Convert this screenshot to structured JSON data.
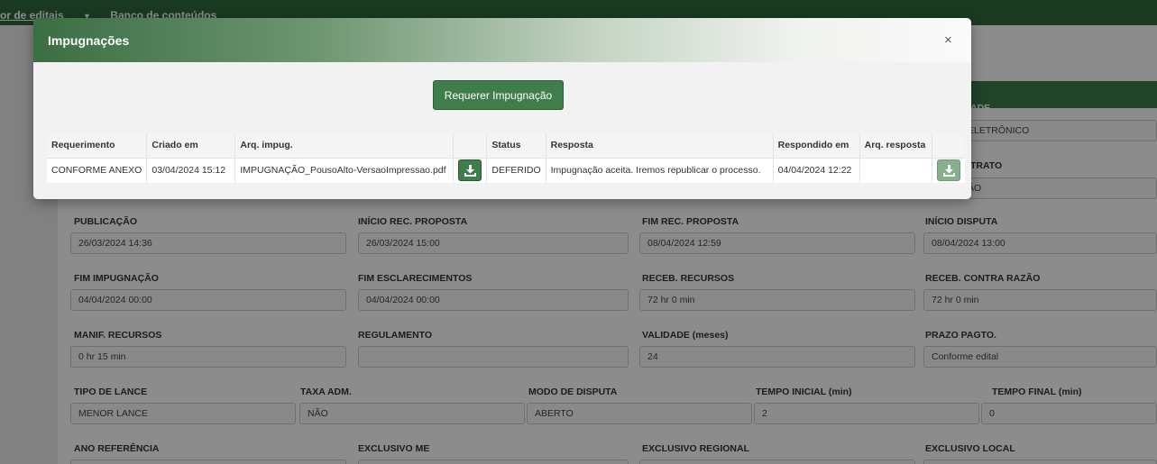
{
  "topbar": {
    "menu_left": "or de editais",
    "menu_dropdown_icon": "▼",
    "menu_right": "Banco de conteúdos"
  },
  "background_form": {
    "partial": {
      "label1": "ADE",
      "value1": "ELETRÔNICO",
      "label2": "TRATO",
      "value2": "ÃO"
    },
    "rows": [
      [
        {
          "label": "PUBLICAÇÃO",
          "value": "26/03/2024 14:36"
        },
        {
          "label": "INÍCIO REC. PROPOSTA",
          "value": "26/03/2024 15:00"
        },
        {
          "label": "FIM REC. PROPOSTA",
          "value": "08/04/2024 12:59"
        },
        {
          "label": "INÍCIO DISPUTA",
          "value": "08/04/2024 13:00"
        }
      ],
      [
        {
          "label": "FIM IMPUGNAÇÃO",
          "value": "04/04/2024 00:00"
        },
        {
          "label": "FIM ESCLARECIMENTOS",
          "value": "04/04/2024 00:00"
        },
        {
          "label": "RECEB. RECURSOS",
          "value": "72 hr 0 min"
        },
        {
          "label": "RECEB. CONTRA RAZÃO",
          "value": "72 hr 0 min"
        }
      ],
      [
        {
          "label": "MANIF. RECURSOS",
          "value": "0 hr 15 min"
        },
        {
          "label": "REGULAMENTO",
          "value": ""
        },
        {
          "label": "VALIDADE (meses)",
          "value": "24"
        },
        {
          "label": "PRAZO PAGTO.",
          "value": "Conforme edital"
        }
      ],
      [
        {
          "label": "TIPO DE LANCE",
          "value": "MENOR LANCE"
        },
        {
          "label": "TAXA ADM.",
          "value": "NÃO"
        },
        {
          "label": "MODO DE DISPUTA",
          "value": "ABERTO"
        },
        {
          "label": "TEMPO INICIAL (min)",
          "value": "2"
        },
        {
          "label": "TEMPO FINAL (min)",
          "value": "0"
        }
      ],
      [
        {
          "label": "ANO REFERÊNCIA",
          "value": ""
        },
        {
          "label": "EXCLUSIVO ME",
          "value": ""
        },
        {
          "label": "EXCLUSIVO REGIONAL",
          "value": ""
        },
        {
          "label": "EXCLUSIVO LOCAL",
          "value": ""
        }
      ]
    ]
  },
  "modal": {
    "title": "Impugnações",
    "close_label": "×",
    "request_button": "Requerer Impugnação",
    "columns": [
      "Requerimento",
      "Criado em",
      "Arq. impug.",
      "",
      "Status",
      "Resposta",
      "Respondido em",
      "Arq. resposta",
      ""
    ],
    "rows": [
      {
        "requerimento": "CONFORME ANEXO",
        "criado_em": "03/04/2024 15:12",
        "arq_impug": "IMPUGNAÇÃO_PousoAlto-VersaoImpressao.pdf",
        "status": "DEFERIDO",
        "resposta": "Impugnação aceita. Iremos republicar o processo.",
        "respondido_em": "04/04/2024 12:22",
        "arq_resposta": ""
      }
    ],
    "download_icon": "download-icon"
  },
  "colors": {
    "brand_green": "#3f7d4a",
    "topbar_green": "#2f6a3d",
    "overlay": "rgba(0,0,0,0.45)"
  }
}
